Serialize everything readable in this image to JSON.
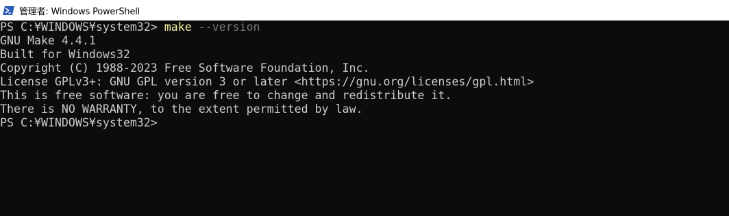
{
  "window": {
    "title": "管理者: Windows PowerShell",
    "app_icon": "powershell-icon",
    "background_color": "#0c0c0c",
    "text_color": "#cccccc",
    "command_color": "#f9f1a5",
    "argument_color": "#767676"
  },
  "console": {
    "prompt": "PS C:¥WINDOWS¥system32> ",
    "command": "make",
    "argument": " --version",
    "output": [
      "GNU Make 4.4.1",
      "Built for Windows32",
      "Copyright (C) 1988-2023 Free Software Foundation, Inc.",
      "License GPLv3+: GNU GPL version 3 or later <https://gnu.org/licenses/gpl.html>",
      "This is free software: you are free to change and redistribute it.",
      "There is NO WARRANTY, to the extent permitted by law."
    ],
    "final_prompt": "PS C:¥WINDOWS¥system32>"
  }
}
